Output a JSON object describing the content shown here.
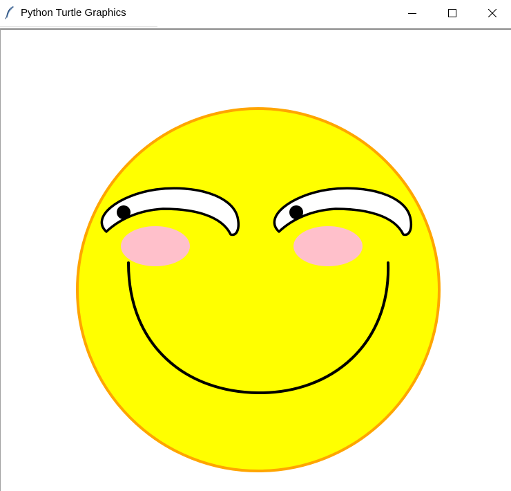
{
  "window": {
    "title": "Python Turtle Graphics",
    "app_icon": "feather-icon",
    "controls": {
      "minimize_icon": "minimize-icon",
      "maximize_icon": "maximize-icon",
      "close_icon": "close-icon"
    }
  },
  "drawing": {
    "face": {
      "fill": "#ffff00",
      "outline": "#ffa500"
    },
    "eyes": {
      "fill": "#ffffff",
      "outline": "#000000",
      "pupil": "#000000"
    },
    "cheeks": {
      "fill": "#ffc0cb"
    },
    "mouth": {
      "stroke": "#000000"
    }
  }
}
